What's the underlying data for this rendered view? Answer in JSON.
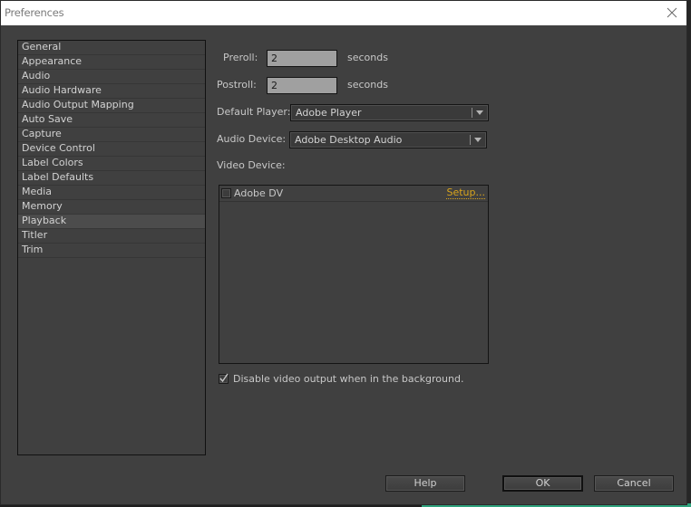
{
  "window": {
    "title": "Preferences",
    "close_icon": "close-icon"
  },
  "sidebar": {
    "selected": "Playback",
    "items": [
      {
        "label": "General"
      },
      {
        "label": "Appearance"
      },
      {
        "label": "Audio"
      },
      {
        "label": "Audio Hardware"
      },
      {
        "label": "Audio Output Mapping"
      },
      {
        "label": "Auto Save"
      },
      {
        "label": "Capture"
      },
      {
        "label": "Device Control"
      },
      {
        "label": "Label Colors"
      },
      {
        "label": "Label Defaults"
      },
      {
        "label": "Media"
      },
      {
        "label": "Memory"
      },
      {
        "label": "Playback"
      },
      {
        "label": "Titler"
      },
      {
        "label": "Trim"
      }
    ]
  },
  "playback": {
    "preroll": {
      "label": "Preroll:",
      "value": "2",
      "unit": "seconds"
    },
    "postroll": {
      "label": "Postroll:",
      "value": "2",
      "unit": "seconds"
    },
    "default_player": {
      "label": "Default Player:",
      "value": "Adobe Player"
    },
    "audio_device": {
      "label": "Audio Device:",
      "value": "Adobe Desktop Audio"
    },
    "video_device": {
      "label": "Video Device:",
      "devices": [
        {
          "name": "Adobe DV",
          "checked": false,
          "setup_label": "Setup..."
        }
      ]
    },
    "disable_bg_output": {
      "label": "Disable video output when in the background.",
      "checked": true
    }
  },
  "buttons": {
    "help": "Help",
    "ok": "OK",
    "cancel": "Cancel"
  },
  "colors": {
    "link": "#d9a41c",
    "panel": "#404040",
    "input": "#a0a0a0"
  }
}
